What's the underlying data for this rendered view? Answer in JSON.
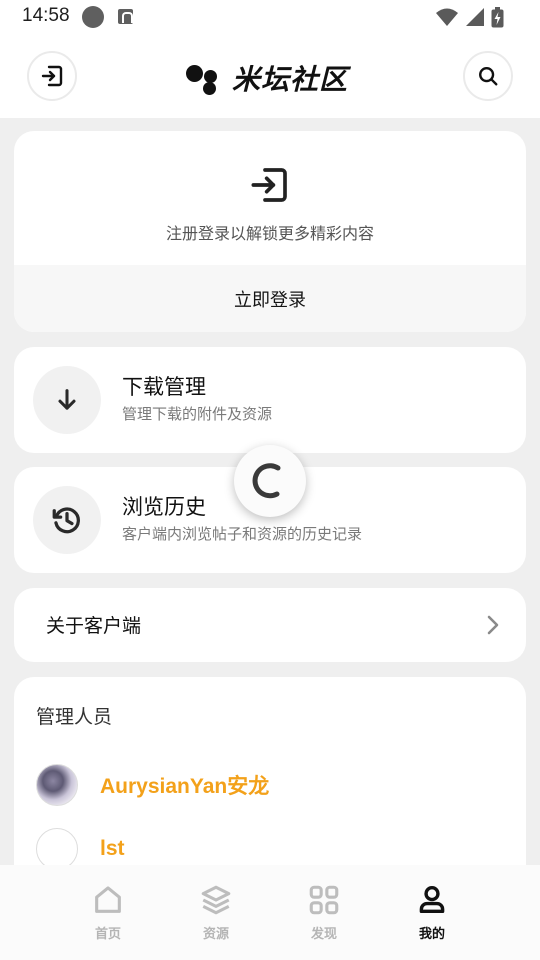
{
  "status_bar": {
    "time": "14:58"
  },
  "header": {
    "brand": "米坛社区"
  },
  "login_card": {
    "hint": "注册登录以解锁更多精彩内容",
    "button": "立即登录"
  },
  "download": {
    "title": "下载管理",
    "subtitle": "管理下载的附件及资源"
  },
  "history": {
    "title": "浏览历史",
    "subtitle": "客户端内浏览帖子和资源的历史记录"
  },
  "about": {
    "label": "关于客户端"
  },
  "admins": {
    "heading": "管理人员",
    "members": [
      {
        "name": "AurysianYan安龙"
      },
      {
        "name": "lst"
      }
    ]
  },
  "nav": {
    "items": [
      {
        "label": "首页",
        "icon": "home-icon"
      },
      {
        "label": "资源",
        "icon": "layers-icon"
      },
      {
        "label": "发现",
        "icon": "grid-icon"
      },
      {
        "label": "我的",
        "icon": "person-icon"
      }
    ],
    "active": "我的"
  },
  "colors": {
    "accent": "#f3a11a",
    "text": "#111111",
    "muted": "#7a7a7a",
    "background": "#efefef"
  }
}
